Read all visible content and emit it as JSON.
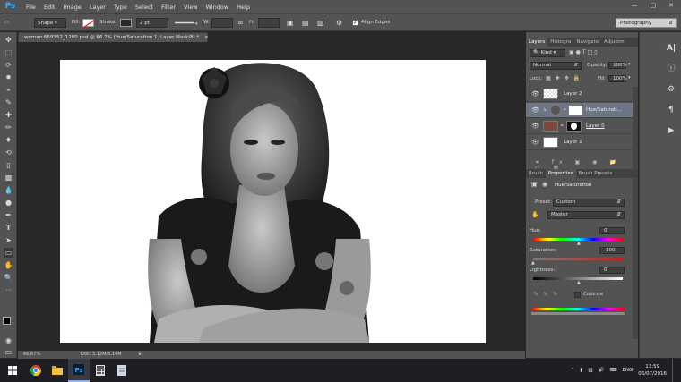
{
  "app": {
    "logo": "Ps"
  },
  "menu": [
    "File",
    "Edit",
    "Image",
    "Layer",
    "Type",
    "Select",
    "Filter",
    "View",
    "Window",
    "Help"
  ],
  "window_controls": [
    "minimize-icon",
    "maximize-icon",
    "close-icon"
  ],
  "options_bar": {
    "mode": "Shape",
    "fill_label": "Fill:",
    "stroke_label": "Stroke:",
    "stroke_width": "2 pt",
    "w_label": "W:",
    "h_label": "H:",
    "align_edges": "Align Edges",
    "align_edges_checked": true,
    "workspace": "Photography"
  },
  "document": {
    "tab_title": "woman-659352_1280.psd @ 66.7% (Hue/Saturation 1, Layer Mask/8) *",
    "close": "×",
    "zoom": "66.67%",
    "doc_size": "Doc: 3.12M/5.14M"
  },
  "layers_panel": {
    "tabs": [
      "Layers",
      "Histogra",
      "Navigato",
      "Adjustm"
    ],
    "active_tab": "Layers",
    "filter_kind": "Kind",
    "blend_mode": "Normal",
    "opacity_label": "Opacity:",
    "opacity": "100%",
    "lock_label": "Lock:",
    "fill_label": "Fill:",
    "fill": "100%",
    "layers": [
      {
        "name": "Layer 2",
        "selected": false
      },
      {
        "name": "Hue/Saturati...",
        "selected": true
      },
      {
        "name": "Layer 0",
        "selected": false
      },
      {
        "name": "Layer 1",
        "selected": false
      }
    ]
  },
  "properties_panel": {
    "tabs": [
      "Brush",
      "Properties",
      "Brush Presets"
    ],
    "active_tab": "Properties",
    "title": "Hue/Saturation",
    "preset_label": "Preset:",
    "preset": "Custom",
    "channel": "Master",
    "hue_label": "Hue:",
    "hue": "0",
    "saturation_label": "Saturation:",
    "saturation": "-100",
    "lightness_label": "Lightness:",
    "lightness": "0",
    "colorize_label": "Colorize",
    "colorize_checked": false
  },
  "taskbar": {
    "lang": "ENG",
    "time": "13:59",
    "date": "06/07/2016",
    "apps": [
      "chrome-icon",
      "file-explorer-icon",
      "photoshop-icon",
      "calculator-icon",
      "notes-icon"
    ]
  },
  "colors": {
    "ui_bg": "#535353",
    "canvas_bg": "#282828",
    "selection": "#6d7586",
    "accent": "#31a8ff"
  }
}
